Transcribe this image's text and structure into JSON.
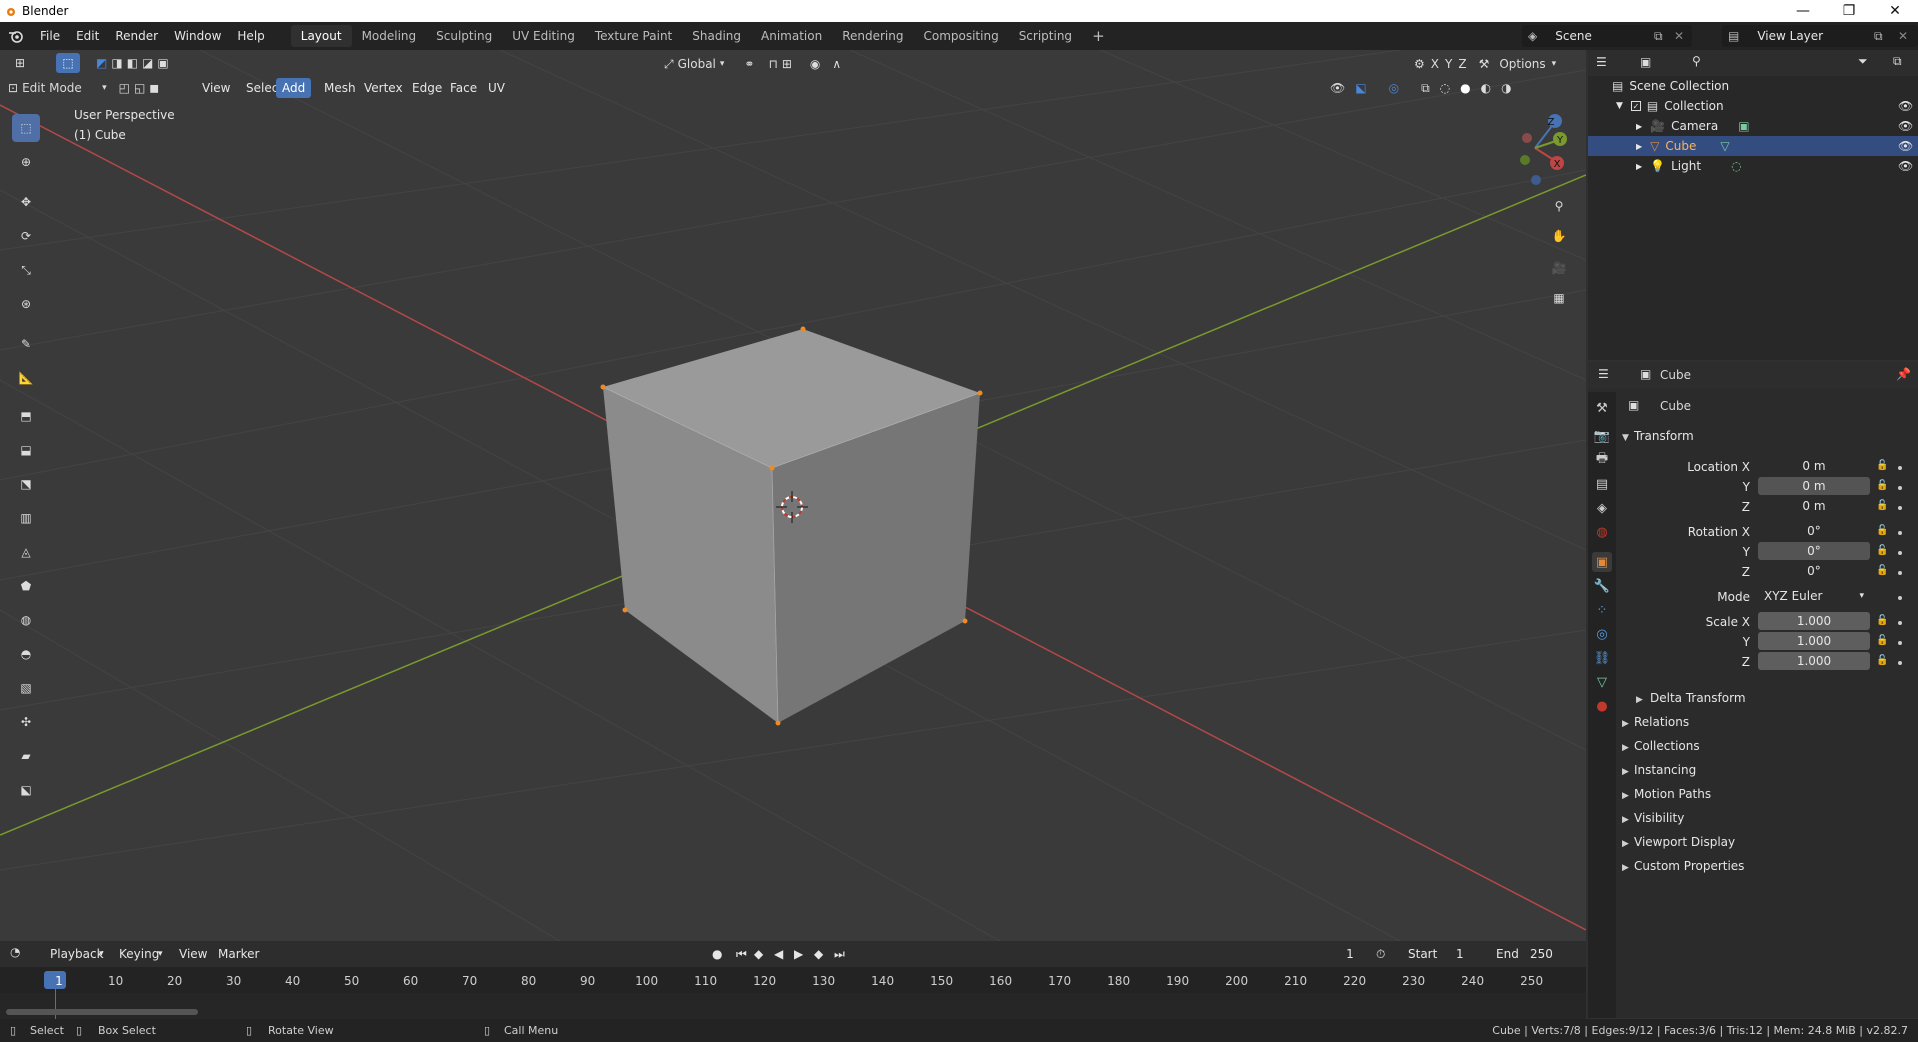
{
  "window": {
    "title": "Blender",
    "controls": [
      "—",
      "❐",
      "✕"
    ]
  },
  "menus": [
    "File",
    "Edit",
    "Render",
    "Window",
    "Help"
  ],
  "workspaces": [
    "Layout",
    "Modeling",
    "Sculpting",
    "UV Editing",
    "Texture Paint",
    "Shading",
    "Animation",
    "Rendering",
    "Compositing",
    "Scripting"
  ],
  "scene": {
    "name": "Scene",
    "view_layer": "View Layer"
  },
  "viewport_header": {
    "mode": "Edit Mode",
    "menus": [
      "View",
      "Select",
      "Add",
      "Mesh",
      "Vertex",
      "Edge",
      "Face",
      "UV"
    ],
    "active_menu": "Add",
    "orientation": "Global",
    "axes": [
      "X",
      "Y",
      "Z"
    ],
    "options": "Options"
  },
  "viewport": {
    "perspective": "User Perspective",
    "object": "(1) Cube"
  },
  "gizmo": {
    "x": "X",
    "y": "Y",
    "z": "Z"
  },
  "outliner": {
    "root": "Scene Collection",
    "collection": "Collection",
    "items": [
      {
        "name": "Camera",
        "icon": "camera-icon"
      },
      {
        "name": "Cube",
        "icon": "mesh-icon",
        "selected": true
      },
      {
        "name": "Light",
        "icon": "light-icon"
      }
    ]
  },
  "properties": {
    "header_object": "Cube",
    "object_name": "Cube",
    "transform_title": "Transform",
    "location": {
      "label": "Location X",
      "x": "0 m",
      "y": "0 m",
      "z": "0 m"
    },
    "rotation": {
      "label": "Rotation X",
      "x": "0°",
      "y": "0°",
      "z": "0°"
    },
    "mode": {
      "label": "Mode",
      "value": "XYZ Euler"
    },
    "scale": {
      "label": "Scale X",
      "x": "1.000",
      "y": "1.000",
      "z": "1.000"
    },
    "axis_y": "Y",
    "axis_z": "Z",
    "delta": "Delta Transform",
    "panels": [
      "Relations",
      "Collections",
      "Instancing",
      "Motion Paths",
      "Visibility",
      "Viewport Display",
      "Custom Properties"
    ]
  },
  "timeline": {
    "menus": [
      "Playback",
      "Keying",
      "View",
      "Marker"
    ],
    "current_frame": "1",
    "start_label": "Start",
    "start": "1",
    "end_label": "End",
    "end": "250",
    "ticks": [
      "1",
      "10",
      "20",
      "30",
      "40",
      "50",
      "60",
      "70",
      "80",
      "90",
      "100",
      "110",
      "120",
      "130",
      "140",
      "150",
      "160",
      "170",
      "180",
      "190",
      "200",
      "210",
      "220",
      "230",
      "240",
      "250"
    ]
  },
  "status": {
    "select": "Select",
    "box_select": "Box Select",
    "rotate_view": "Rotate View",
    "call_menu": "Call Menu",
    "stats": "Cube | Verts:7/8 | Edges:9/12 | Faces:3/6 | Tris:12 | Mem: 24.8 MiB | v2.82.7"
  },
  "colors": {
    "accent": "#4772b3",
    "selected_row": "#334d80",
    "x_axis": "#c04545",
    "y_axis": "#7a9a2e",
    "vertex": "#f08a24"
  }
}
